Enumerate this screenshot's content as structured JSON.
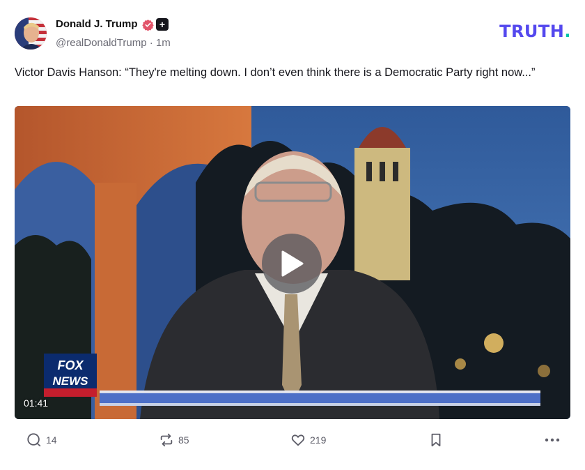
{
  "post": {
    "author_name": "Donald J. Trump",
    "handle": "@realDonaldTrump",
    "time": "1m",
    "meta_text": "@realDonaldTrump · 1m",
    "text": "Victor Davis Hanson: “They're melting down. I don’t even think there is a Democratic Party right now...”"
  },
  "brand": {
    "logo_main": "TRUTH",
    "logo_dot": ".",
    "logo_color": "#5448ee",
    "dot_color": "#00c4a7"
  },
  "video": {
    "duration": "01:41",
    "channel_logo": "FOX NEWS",
    "play_icon": "play-icon"
  },
  "actions": {
    "replies": "14",
    "retruths": "85",
    "likes": "219"
  },
  "icons": {
    "verified": "verified-badge-icon",
    "plus": "plus-badge-icon",
    "reply": "reply-icon",
    "retruth": "retruth-icon",
    "like": "heart-icon",
    "bookmark": "bookmark-icon",
    "more": "more-icon"
  },
  "colors": {
    "verified_badge": "#e2546a",
    "muted_text": "#6b6b75"
  }
}
